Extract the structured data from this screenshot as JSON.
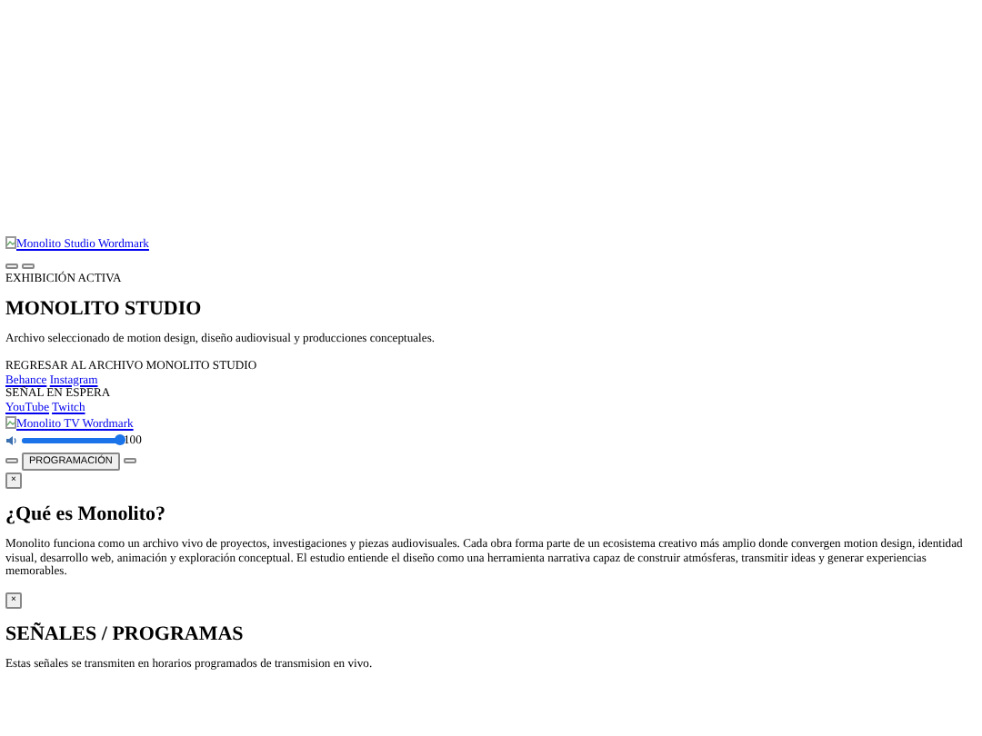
{
  "header": {
    "logo_alt": "Monolito Studio Wordmark",
    "status": "EXHIBICIÓN ACTIVA",
    "title": "MONOLITO STUDIO",
    "subtitle": "Archivo seleccionado de motion design, diseño audiovisual y producciones conceptuales."
  },
  "back_label": "REGRESAR AL ARCHIVO MONOLITO STUDIO",
  "social_links": [
    "Behance",
    "Instagram"
  ],
  "signal_status": "SEÑAL EN ESPERA",
  "stream_links": [
    "YouTube",
    "Twitch"
  ],
  "tv_logo_alt": "Monolito TV Wordmark",
  "volume": {
    "level": 1,
    "reading": "100"
  },
  "schedule_button": "PROGRAMACIÓN",
  "close_button": "×",
  "about": {
    "title": "¿Qué es Monolito?",
    "text": "Monolito funciona como un archivo vivo de proyectos, investigaciones y piezas audiovisuales. Cada obra forma parte de un ecosistema creativo más amplio donde convergen motion design, identidad visual, desarrollo web, animación y exploración conceptual. El estudio entiende el diseño como una herramienta narrativa capaz de construir atmósferas, transmitir ideas y generar experiencias memorables.",
    "close_button": "×"
  },
  "signals": {
    "title": "SEÑALES / PROGRAMAS",
    "text": "Estas señales se transmiten en horarios programados de transmision en vivo."
  }
}
